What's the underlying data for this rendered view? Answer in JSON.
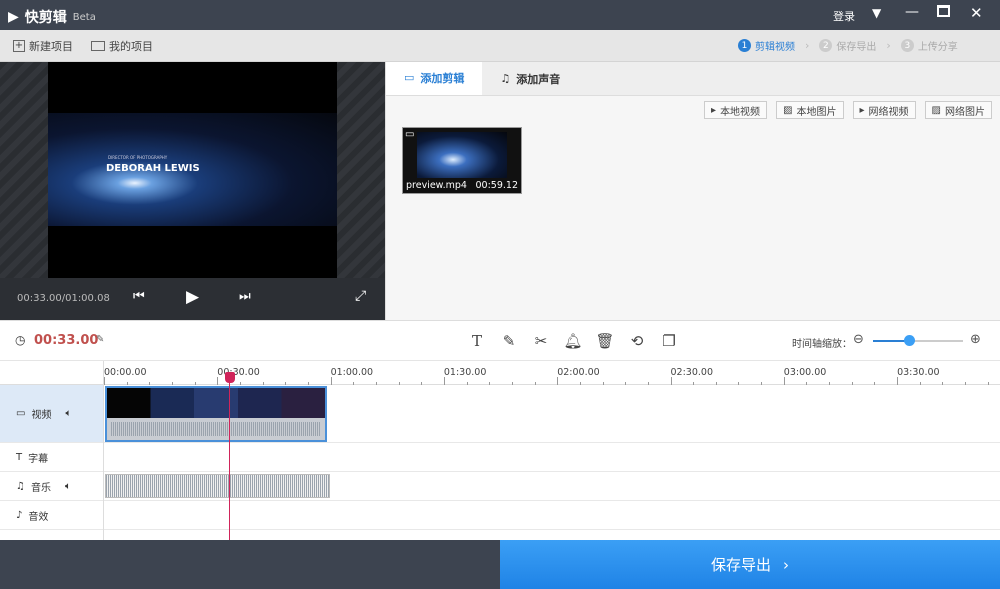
{
  "app": {
    "title": "快剪辑",
    "badge": "Beta",
    "login": "登录"
  },
  "toolbar": {
    "new_project": "新建项目",
    "my_projects": "我的项目"
  },
  "steps": [
    {
      "num": "1",
      "label": "剪辑视频"
    },
    {
      "num": "2",
      "label": "保存导出"
    },
    {
      "num": "3",
      "label": "上传分享"
    }
  ],
  "preview": {
    "time": "00:33.00/01:00.08",
    "video_caption_small": "DIRECTOR OF PHOTOGRAPHY",
    "video_caption": "DEBORAH LEWIS"
  },
  "panel": {
    "tabs": [
      "添加剪辑",
      "添加声音"
    ],
    "sources": [
      "本地视频",
      "本地图片",
      "网络视频",
      "网络图片"
    ],
    "media": [
      {
        "name": "preview.mp4",
        "duration": "00:59.12"
      }
    ]
  },
  "timeline": {
    "current": "00:33.00",
    "zoom_label": "时间轴缩放：",
    "zoom_level": 0.4,
    "ticks": [
      "00:00.00",
      "00:30.00",
      "01:00.00",
      "01:30.00",
      "02:00.00",
      "02:30.00",
      "03:00.00",
      "03:30.00"
    ],
    "tracks": [
      "视频",
      "字幕",
      "音乐",
      "音效"
    ],
    "playhead_seconds": 33
  },
  "export_button": "保存导出",
  "colors": {
    "accent": "#2a7fd4",
    "playhead": "#d0245a",
    "time": "#c0504d"
  }
}
